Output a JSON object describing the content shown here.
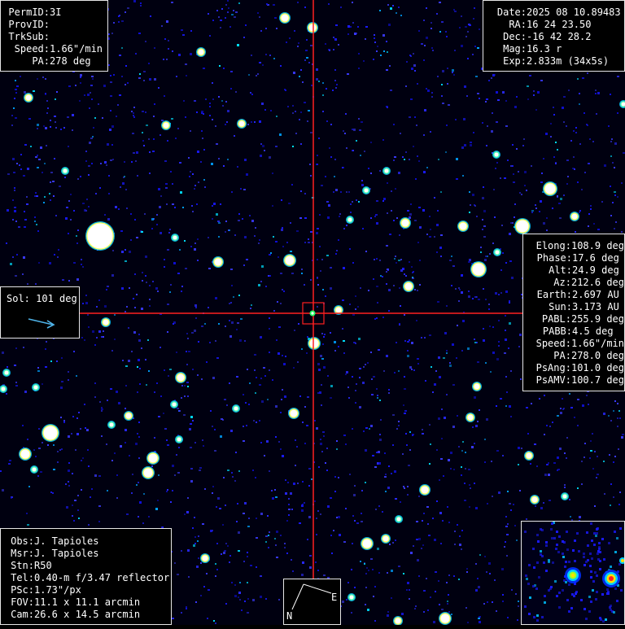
{
  "top_left": {
    "rows": [
      {
        "label": "PermID:",
        "value": "3I"
      },
      {
        "label": "ProvID:",
        "value": ""
      },
      {
        "label": "TrkSub:",
        "value": ""
      },
      {
        "label": "Speed:",
        "value": "1.66\"/min"
      },
      {
        "label": "PA:",
        "value": "278 deg"
      }
    ]
  },
  "top_right": {
    "rows": [
      {
        "label": "Date:",
        "value": "2025 08 10.89483"
      },
      {
        "label": "RA:",
        "value": "16 24 23.50"
      },
      {
        "label": "Dec:",
        "value": "-16 42 28.2"
      },
      {
        "label": "Mag:",
        "value": "16.3 r"
      },
      {
        "label": "Exp:",
        "value": "2.833m (34x5s)"
      }
    ]
  },
  "right_mid": {
    "rows": [
      {
        "label": "Elong:",
        "value": "108.9 deg"
      },
      {
        "label": "Phase:",
        "value": "17.6 deg"
      },
      {
        "label": "Alt:",
        "value": "24.9 deg"
      },
      {
        "label": "Az:",
        "value": "212.6 deg"
      },
      {
        "label": "Earth:",
        "value": "2.697 AU"
      },
      {
        "label": "Sun:",
        "value": "3.173 AU"
      },
      {
        "label": "PABL:",
        "value": "255.9 deg"
      },
      {
        "label": "PABB:",
        "value": "4.5 deg"
      },
      {
        "label": "Speed:",
        "value": "1.66\"/min"
      },
      {
        "label": "PA:",
        "value": "278.0 deg"
      },
      {
        "label": "PsAng:",
        "value": "101.0 deg"
      },
      {
        "label": "PsAMV:",
        "value": "100.7 deg"
      }
    ]
  },
  "sol": {
    "label": "Sol:",
    "value": "101 deg",
    "arrow_color": "#4fb3e8"
  },
  "bottom_left": {
    "rows": [
      {
        "label": "Obs:",
        "value": "J. Tapioles"
      },
      {
        "label": "Msr:",
        "value": "J. Tapioles"
      },
      {
        "label": "Stn:",
        "value": "R50"
      },
      {
        "label": "Tel:",
        "value": "0.40-m f/3.47 reflector"
      },
      {
        "label": "PSc:",
        "value": "1.73\"/px"
      },
      {
        "label": "FOV:",
        "value": "11.1 x 11.1 arcmin"
      },
      {
        "label": "Cam:",
        "value": "26.6 x 14.5 arcmin"
      }
    ]
  },
  "compass": {
    "north_label": "N",
    "east_label": "E"
  },
  "colors": {
    "crosshair": "#ff2020",
    "target_box": "#ff2020",
    "sky_background": "#000010",
    "panel_border": "#e6e6e6",
    "noise_blue": "#1414ff",
    "star_core": "#ffffff",
    "star_halo": "#00e0ff"
  }
}
